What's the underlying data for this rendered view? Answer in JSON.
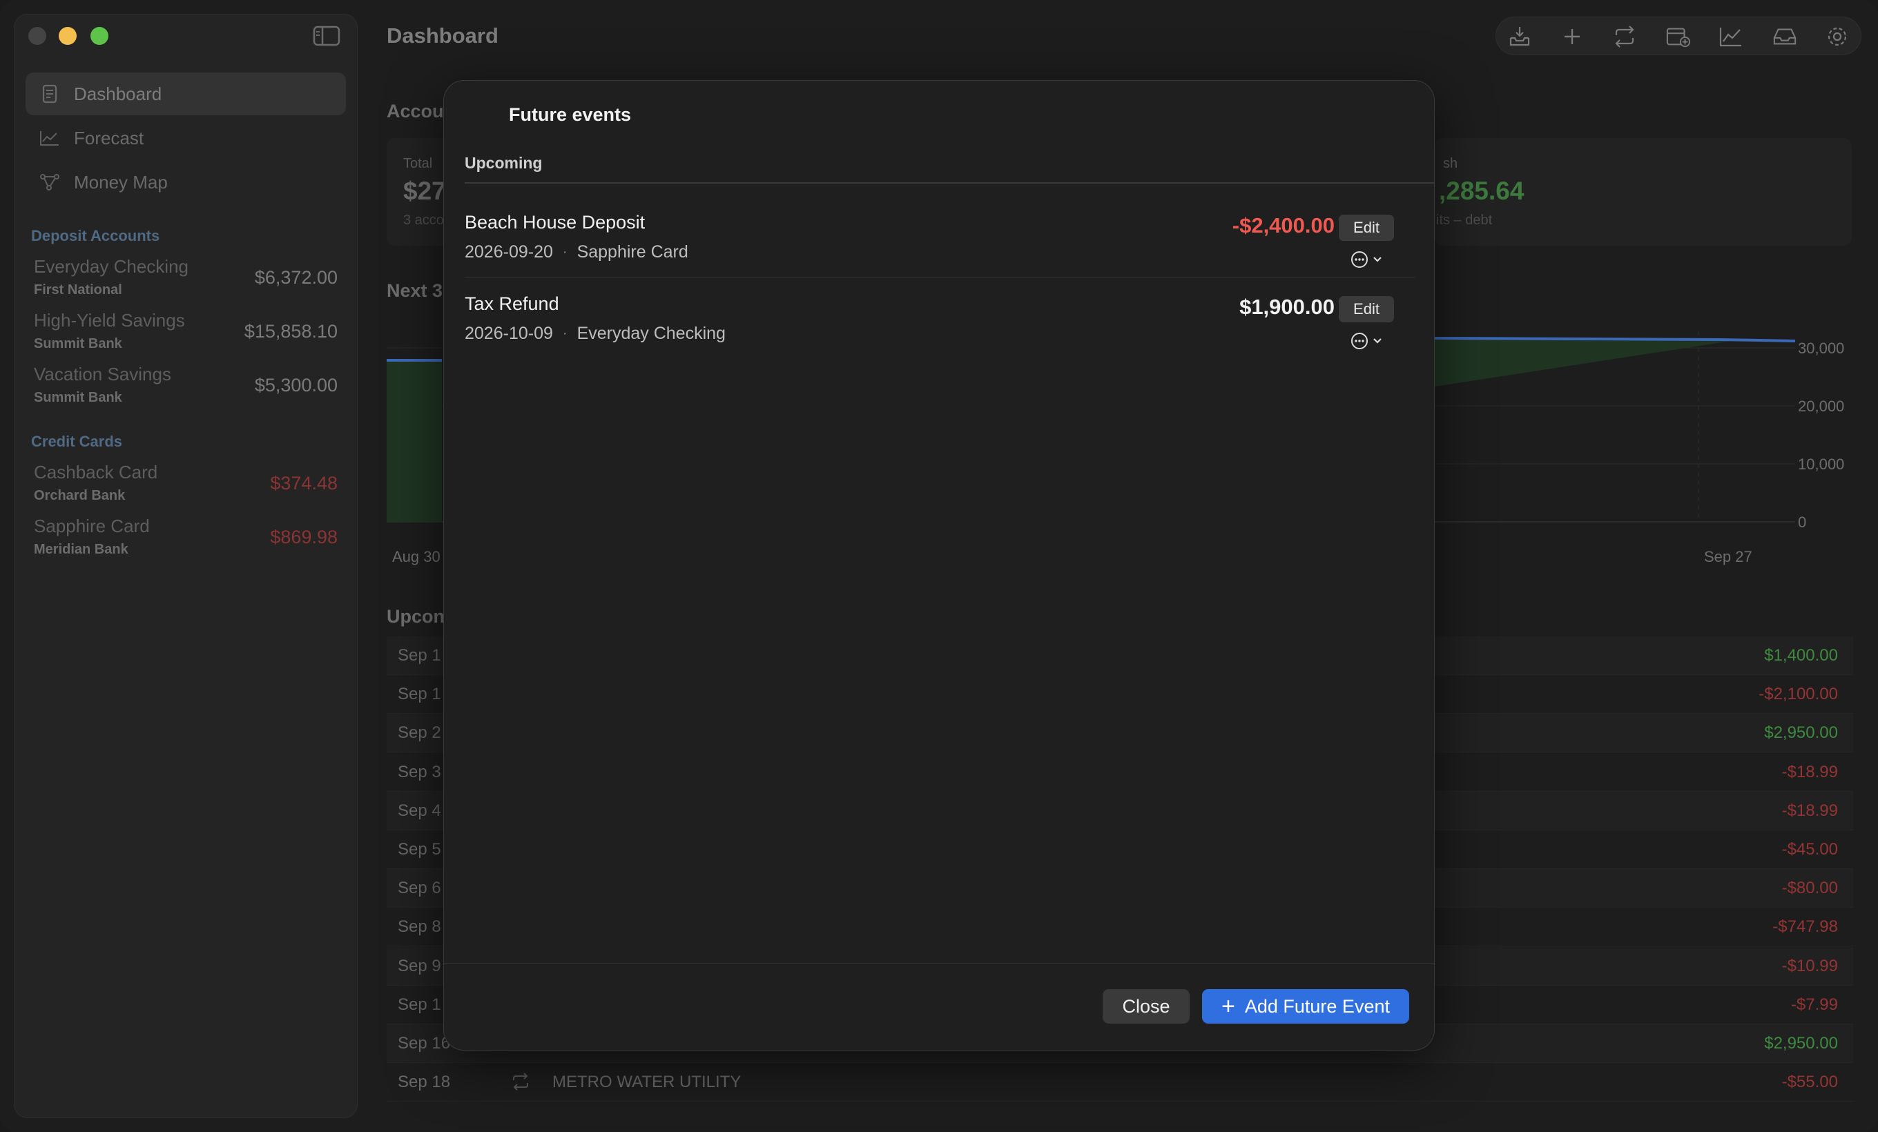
{
  "window": {
    "title": "Dashboard"
  },
  "sidebar": {
    "nav": [
      {
        "label": "Dashboard",
        "icon": "dashboard-icon"
      },
      {
        "label": "Forecast",
        "icon": "chart-line-icon"
      },
      {
        "label": "Money Map",
        "icon": "network-icon"
      }
    ],
    "deposit_title": "Deposit Accounts",
    "deposit_accounts": [
      {
        "name": "Everyday Checking",
        "institution": "First National",
        "balance": "$6,372.00"
      },
      {
        "name": "High-Yield Savings",
        "institution": "Summit Bank",
        "balance": "$15,858.10"
      },
      {
        "name": "Vacation Savings",
        "institution": "Summit Bank",
        "balance": "$5,300.00"
      }
    ],
    "credit_title": "Credit Cards",
    "credit_cards": [
      {
        "name": "Cashback Card",
        "institution": "Orchard Bank",
        "balance": "$374.48"
      },
      {
        "name": "Sapphire Card",
        "institution": "Meridian Bank",
        "balance": "$869.98"
      }
    ]
  },
  "toolbar": {
    "icons": [
      "import-icon",
      "plus-icon",
      "transfer-icon",
      "calendar-add-icon",
      "chart-icon",
      "inbox-icon",
      "gear-icon"
    ]
  },
  "background": {
    "accounts_title": "Accou",
    "card_left": {
      "label": "Total",
      "value": "$27",
      "sub": "3 acco"
    },
    "card_right": {
      "label": "sh",
      "value": ",285.64",
      "sub": "its – debt"
    },
    "next_title": "Next 3",
    "chart_y_ticks": [
      "30,000",
      "20,000",
      "10,000",
      "0"
    ],
    "chart_x_ticks": [
      "Aug 30",
      "Sep 27"
    ],
    "upcoming_title": "Upcon",
    "upcoming_rows": [
      {
        "date": "Sep 1",
        "desc": "",
        "amount": "$1,400.00",
        "positive": true
      },
      {
        "date": "Sep 1",
        "desc": "",
        "amount": "-$2,100.00",
        "positive": false
      },
      {
        "date": "Sep 2",
        "desc": "",
        "amount": "$2,950.00",
        "positive": true
      },
      {
        "date": "Sep 3",
        "desc": "",
        "amount": "-$18.99",
        "positive": false
      },
      {
        "date": "Sep 4",
        "desc": "",
        "amount": "-$18.99",
        "positive": false
      },
      {
        "date": "Sep 5",
        "desc": "",
        "amount": "-$45.00",
        "positive": false
      },
      {
        "date": "Sep 6",
        "desc": "",
        "amount": "-$80.00",
        "positive": false
      },
      {
        "date": "Sep 8",
        "desc": "",
        "amount": "-$747.98",
        "positive": false
      },
      {
        "date": "Sep 9",
        "desc": "",
        "amount": "-$10.99",
        "positive": false
      },
      {
        "date": "Sep 1",
        "desc": "",
        "amount": "-$7.99",
        "positive": false
      },
      {
        "date": "Sep 16",
        "desc": "",
        "amount": "$2,950.00",
        "positive": true
      },
      {
        "date": "Sep 18",
        "desc": "METRO WATER UTILITY",
        "amount": "-$55.00",
        "positive": false
      }
    ]
  },
  "modal": {
    "title": "Future events",
    "section": "Upcoming",
    "events": [
      {
        "name": "Beach House Deposit",
        "date": "2026-09-20",
        "account": "Sapphire Card",
        "amount": "-$2,400.00",
        "negative": true,
        "edit_label": "Edit"
      },
      {
        "name": "Tax Refund",
        "date": "2026-10-09",
        "account": "Everyday Checking",
        "amount": "$1,900.00",
        "negative": false,
        "edit_label": "Edit"
      }
    ],
    "meta_separator": "·",
    "close_label": "Close",
    "add_label": "Add Future Event",
    "add_symbol": "+"
  }
}
